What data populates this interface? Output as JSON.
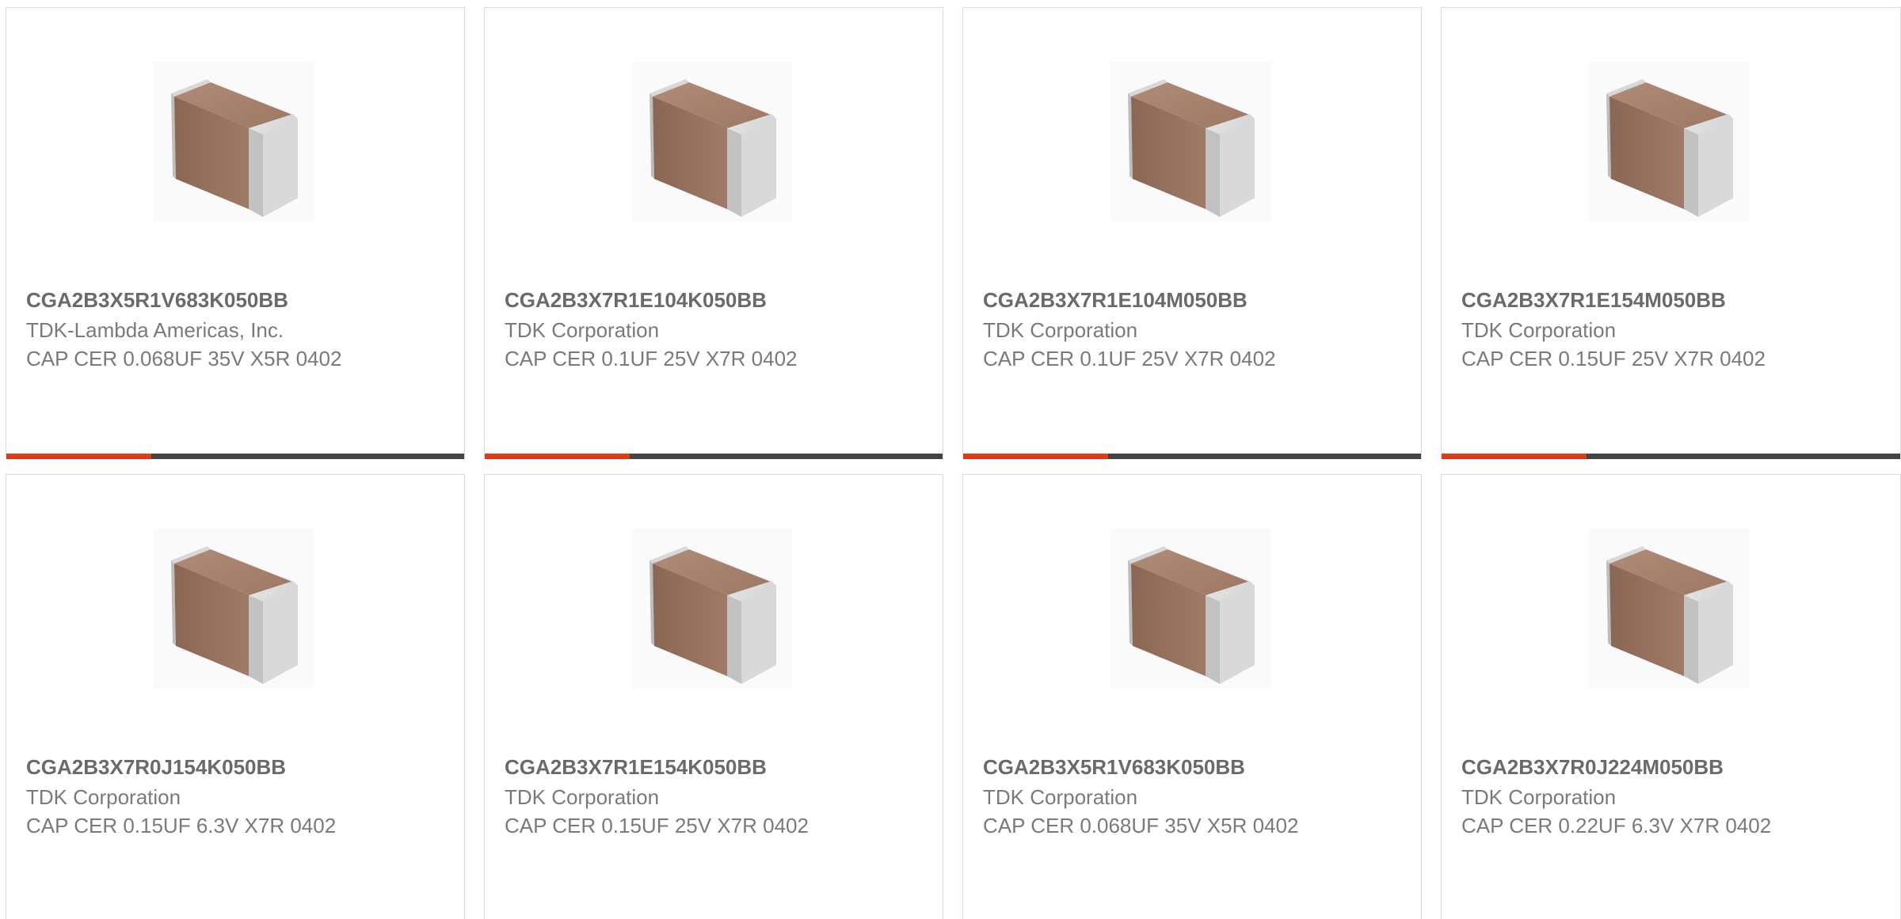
{
  "colors": {
    "accent": "#e03a17",
    "bar": "#444444",
    "card_border": "#dcdcdc"
  },
  "products": [
    {
      "part_number": "CGA2B3X5R1V683K050BB",
      "manufacturer": "TDK-Lambda Americas, Inc.",
      "description": "CAP CER 0.068UF 35V X5R 0402",
      "image_icon": "ceramic-capacitor-icon"
    },
    {
      "part_number": "CGA2B3X7R1E104K050BB",
      "manufacturer": "TDK Corporation",
      "description": "CAP CER 0.1UF 25V X7R 0402",
      "image_icon": "ceramic-capacitor-icon"
    },
    {
      "part_number": "CGA2B3X7R1E104M050BB",
      "manufacturer": "TDK Corporation",
      "description": "CAP CER 0.1UF 25V X7R 0402",
      "image_icon": "ceramic-capacitor-icon"
    },
    {
      "part_number": "CGA2B3X7R1E154M050BB",
      "manufacturer": "TDK Corporation",
      "description": "CAP CER 0.15UF 25V X7R 0402",
      "image_icon": "ceramic-capacitor-icon"
    },
    {
      "part_number": "CGA2B3X7R0J154K050BB",
      "manufacturer": "TDK Corporation",
      "description": "CAP CER 0.15UF 6.3V X7R 0402",
      "image_icon": "ceramic-capacitor-icon"
    },
    {
      "part_number": "CGA2B3X7R1E154K050BB",
      "manufacturer": "TDK Corporation",
      "description": "CAP CER 0.15UF 25V X7R 0402",
      "image_icon": "ceramic-capacitor-icon"
    },
    {
      "part_number": "CGA2B3X5R1V683K050BB",
      "manufacturer": "TDK Corporation",
      "description": "CAP CER 0.068UF 35V X5R 0402",
      "image_icon": "ceramic-capacitor-icon"
    },
    {
      "part_number": "CGA2B3X7R0J224M050BB",
      "manufacturer": "TDK Corporation",
      "description": "CAP CER 0.22UF 6.3V X7R 0402",
      "image_icon": "ceramic-capacitor-icon"
    }
  ]
}
